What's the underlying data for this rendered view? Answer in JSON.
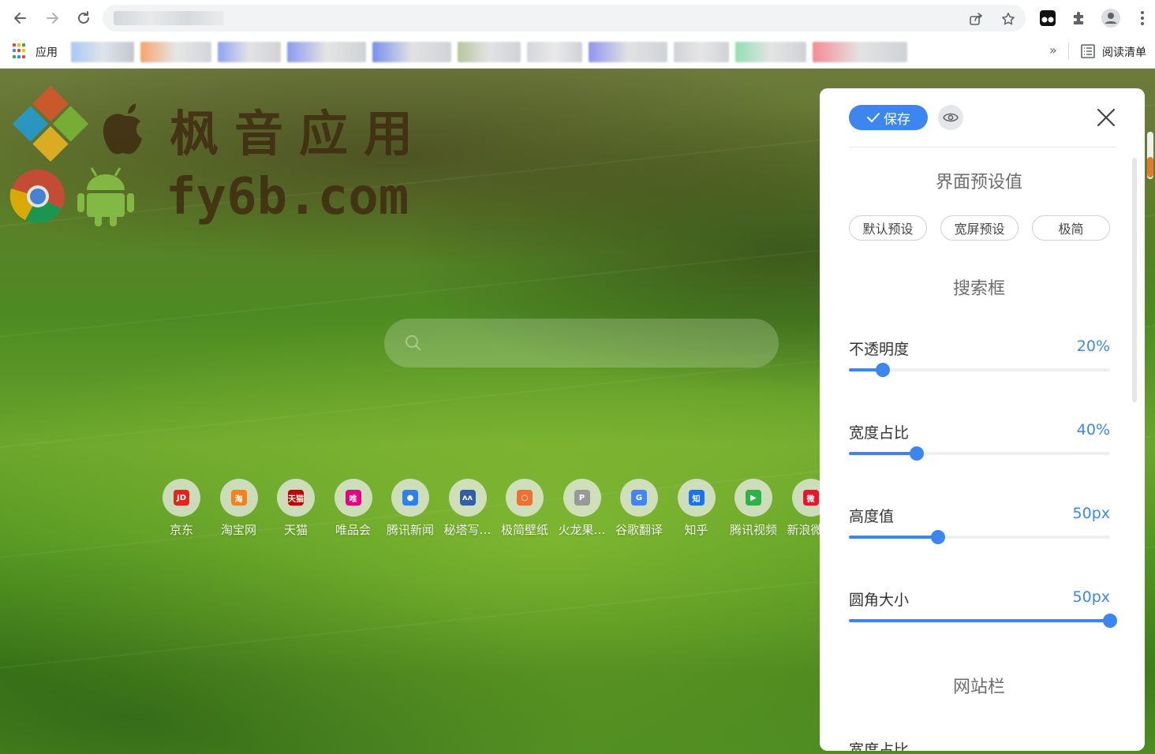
{
  "browser": {
    "address_bar_value": "",
    "bookmarks_bar": {
      "apps_label": "应用",
      "overflow_label": "»",
      "reading_list_label": "阅读清单"
    }
  },
  "page": {
    "watermark": {
      "title": "枫音应用",
      "domain": "fy6b.com"
    },
    "search": {
      "placeholder": ""
    },
    "sites": [
      {
        "label": "京东",
        "glyph": "JD",
        "color": "#e1251b"
      },
      {
        "label": "淘宝网",
        "glyph": "淘",
        "color": "#f4811f"
      },
      {
        "label": "天猫",
        "glyph": "天猫",
        "color": "#c40000"
      },
      {
        "label": "唯品会",
        "glyph": "唯",
        "color": "#e5007f"
      },
      {
        "label": "腾讯新闻",
        "glyph": "●",
        "color": "#2b83e8"
      },
      {
        "label": "秘塔写…",
        "glyph": "ʌʌ",
        "color": "#2e5fa8"
      },
      {
        "label": "极简壁纸",
        "glyph": "○",
        "color": "#f07030"
      },
      {
        "label": "火龙果…",
        "glyph": "P",
        "color": "#999999"
      },
      {
        "label": "谷歌翻译",
        "glyph": "G",
        "color": "#4285f4"
      },
      {
        "label": "知乎",
        "glyph": "知",
        "color": "#1772f6"
      },
      {
        "label": "腾讯视频",
        "glyph": "▶",
        "color": "#2db24a"
      },
      {
        "label": "新浪微博",
        "glyph": "微",
        "color": "#e6162d"
      }
    ]
  },
  "settings_panel": {
    "save_label": "保存",
    "interface_presets_title": "界面预设值",
    "presets": [
      {
        "label": "默认预设"
      },
      {
        "label": "宽屏预设"
      },
      {
        "label": "极简"
      }
    ],
    "search_section_title": "搜索框",
    "search_options": [
      {
        "label": "不透明度",
        "value": "20%",
        "fraction": 0.13
      },
      {
        "label": "宽度占比",
        "value": "40%",
        "fraction": 0.26
      },
      {
        "label": "高度值",
        "value": "50px",
        "fraction": 0.34
      },
      {
        "label": "圆角大小",
        "value": "50px",
        "fraction": 1.0
      }
    ],
    "sites_section_title": "网站栏",
    "sites_first_option_label": "宽度占比"
  },
  "colors": {
    "accent": "#3d86f0",
    "page_scrollbar_thumb": "#e07a2e"
  }
}
